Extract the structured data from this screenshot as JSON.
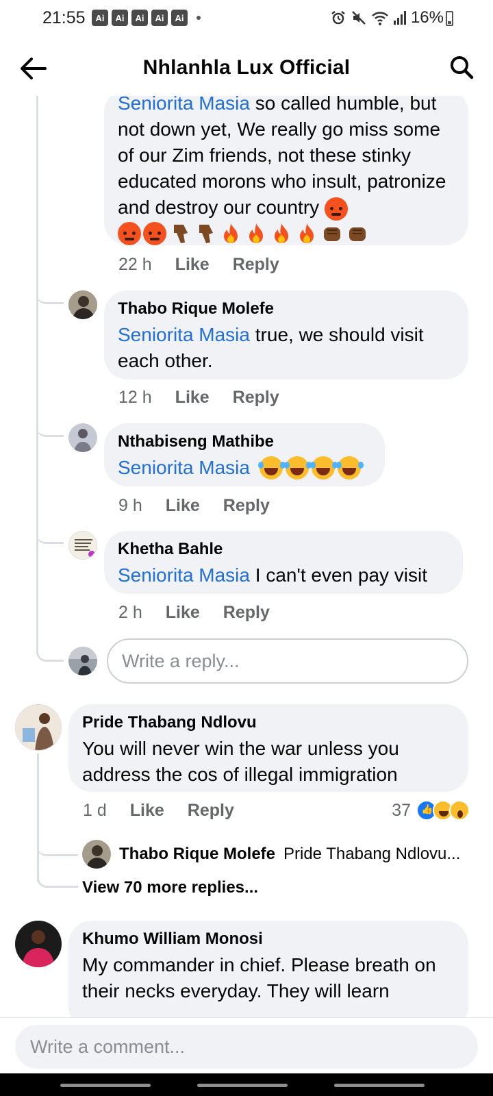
{
  "status_bar": {
    "time": "21:55",
    "notification_badges": [
      "Ai",
      "Ai",
      "Ai",
      "Ai",
      "Ai"
    ],
    "battery": "16%"
  },
  "header": {
    "title": "Nhlanhla Lux Official"
  },
  "comments": {
    "c1": {
      "mention": "Seniorita Masia",
      "text": "so called humble, but not down yet, We really go miss some of our Zim friends, not these stinky educated morons who insult, patronize and destroy our country",
      "time": "22 h",
      "like": "Like",
      "reply": "Reply"
    },
    "c2": {
      "author": "Thabo Rique Molefe",
      "mention": "Seniorita Masia",
      "text": "true, we should visit each other.",
      "time": "12 h",
      "like": "Like",
      "reply": "Reply"
    },
    "c3": {
      "author": "Nthabiseng Mathibe",
      "mention": "Seniorita Masia",
      "time": "9 h",
      "like": "Like",
      "reply": "Reply"
    },
    "c4": {
      "author": "Khetha Bahle",
      "mention": "Seniorita Masia",
      "text": "I can't even pay visit",
      "time": "2 h",
      "like": "Like",
      "reply": "Reply"
    },
    "reply_placeholder": "Write a reply...",
    "c5": {
      "author": "Pride Thabang Ndlovu",
      "text": "You will never win the war unless you address the cos of illegal immigration",
      "time": "1 d",
      "like": "Like",
      "reply": "Reply",
      "reaction_count": "37",
      "reactions": [
        "like",
        "haha",
        "wow"
      ]
    },
    "collapsed_reply": {
      "author": "Thabo Rique Molefe",
      "snippet": "Pride Thabang Ndlovu..."
    },
    "view_more": "View 70 more replies...",
    "c6": {
      "author": "Khumo William Monosi",
      "text": "My commander in chief. Please breath on their necks everyday. They will learn"
    }
  },
  "composer": {
    "placeholder": "Write a comment..."
  },
  "colors": {
    "mention": "#216fdb",
    "bubble": "#f0f2f5",
    "meta": "#65676b"
  }
}
